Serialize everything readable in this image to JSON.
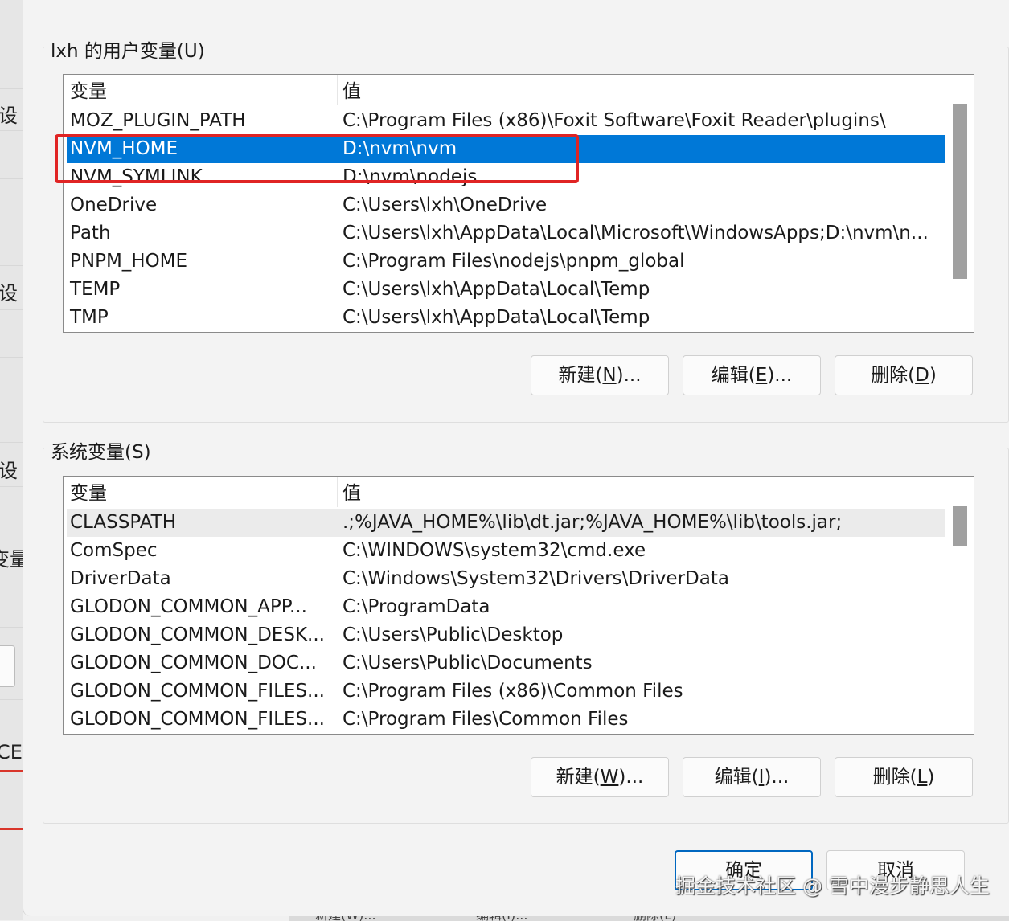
{
  "background_window": {
    "items": [
      "设",
      "设",
      "设",
      "变量",
      "CE"
    ],
    "bottom_buttons": [
      "新建(W)...",
      "编辑(I)...",
      "删除(L)"
    ]
  },
  "user_vars": {
    "group_title": "lxh 的用户变量(U)",
    "columns": [
      "变量",
      "值"
    ],
    "rows": [
      {
        "name": "MOZ_PLUGIN_PATH",
        "value": "C:\\Program Files (x86)\\Foxit Software\\Foxit Reader\\plugins\\"
      },
      {
        "name": "NVM_HOME",
        "value": "D:\\nvm\\nvm"
      },
      {
        "name": "NVM_SYMLINK",
        "value": "D:\\nvm\\nodejs"
      },
      {
        "name": "OneDrive",
        "value": "C:\\Users\\lxh\\OneDrive"
      },
      {
        "name": "Path",
        "value": "C:\\Users\\lxh\\AppData\\Local\\Microsoft\\WindowsApps;D:\\nvm\\n..."
      },
      {
        "name": "PNPM_HOME",
        "value": "C:\\Program Files\\nodejs\\pnpm_global"
      },
      {
        "name": "TEMP",
        "value": "C:\\Users\\lxh\\AppData\\Local\\Temp"
      },
      {
        "name": "TMP",
        "value": "C:\\Users\\lxh\\AppData\\Local\\Temp"
      }
    ],
    "selected_row": "NVM_HOME",
    "buttons": {
      "new": {
        "label": "新建(",
        "key": "N",
        "suffix": ")..."
      },
      "edit": {
        "label": "编辑(",
        "key": "E",
        "suffix": ")..."
      },
      "delete": {
        "label": "删除(",
        "key": "D",
        "suffix": ")"
      }
    }
  },
  "system_vars": {
    "group_title": "系统变量(S)",
    "columns": [
      "变量",
      "值"
    ],
    "rows": [
      {
        "name": "CLASSPATH",
        "value": ".;%JAVA_HOME%\\lib\\dt.jar;%JAVA_HOME%\\lib\\tools.jar;"
      },
      {
        "name": "ComSpec",
        "value": "C:\\WINDOWS\\system32\\cmd.exe"
      },
      {
        "name": "DriverData",
        "value": "C:\\Windows\\System32\\Drivers\\DriverData"
      },
      {
        "name": "GLODON_COMMON_APP...",
        "value": "C:\\ProgramData"
      },
      {
        "name": "GLODON_COMMON_DESK...",
        "value": "C:\\Users\\Public\\Desktop"
      },
      {
        "name": "GLODON_COMMON_DOC...",
        "value": "C:\\Users\\Public\\Documents"
      },
      {
        "name": "GLODON_COMMON_FILES...",
        "value": "C:\\Program Files (x86)\\Common Files"
      },
      {
        "name": "GLODON_COMMON_FILES...",
        "value": "C:\\Program Files\\Common Files"
      }
    ],
    "buttons": {
      "new": {
        "label": "新建(",
        "key": "W",
        "suffix": ")..."
      },
      "edit": {
        "label": "编辑(",
        "key": "I",
        "suffix": ")..."
      },
      "delete": {
        "label": "删除(",
        "key": "L",
        "suffix": ")"
      }
    }
  },
  "dialog_buttons": {
    "ok": "确定",
    "cancel": "取消"
  },
  "watermark": "掘金技术社区 @ 雪中漫步静思人生",
  "colors": {
    "selection": "#0078d7",
    "highlight_box": "#e02424",
    "default_button_border": "#0067c0"
  }
}
